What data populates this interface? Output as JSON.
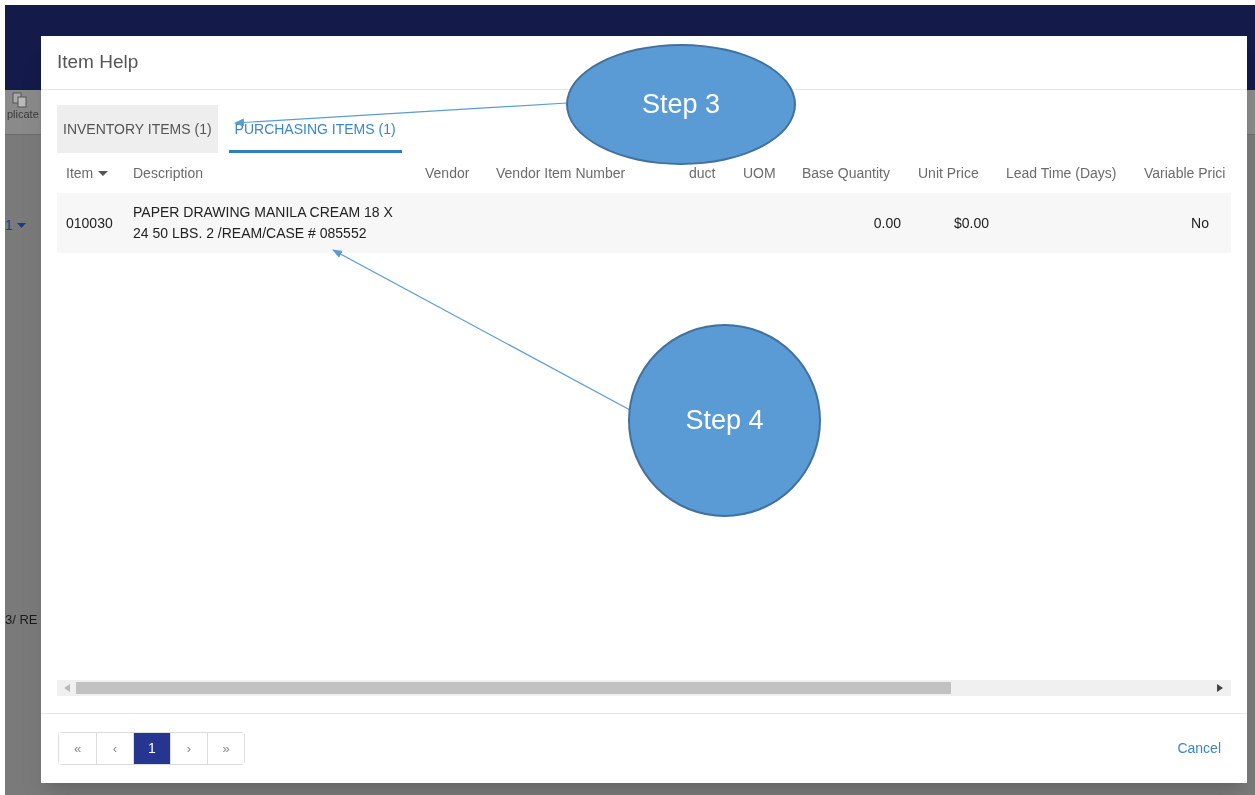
{
  "background": {
    "toolbar_label": "plicate",
    "field_value": "1",
    "text_fragment": "3/ RE"
  },
  "dialog": {
    "title": "Item Help",
    "tabs": [
      {
        "label": "INVENTORY ITEMS (1)",
        "selected": false
      },
      {
        "label": "PURCHASING ITEMS (1)",
        "selected": true
      }
    ],
    "table": {
      "columns": [
        {
          "label": "Item",
          "sorted": true,
          "kind": "text"
        },
        {
          "label": "Description",
          "sorted": false,
          "kind": "text"
        },
        {
          "label": "Vendor",
          "sorted": false,
          "kind": "text"
        },
        {
          "label": "Vendor Item Number",
          "sorted": false,
          "kind": "text"
        },
        {
          "label": "duct",
          "sorted": false,
          "kind": "text"
        },
        {
          "label": "UOM",
          "sorted": false,
          "kind": "text"
        },
        {
          "label": "Base Quantity",
          "sorted": false,
          "kind": "number"
        },
        {
          "label": "Unit Price",
          "sorted": false,
          "kind": "number"
        },
        {
          "label": "Lead Time (Days)",
          "sorted": false,
          "kind": "number"
        },
        {
          "label": "Variable Prici",
          "sorted": false,
          "kind": "number"
        }
      ],
      "rows": [
        {
          "cells": [
            "010030",
            "PAPER DRAWING MANILA CREAM 18 X 24 50 LBS. 2 /REAM/CASE # 085552",
            null,
            null,
            null,
            null,
            "0.00",
            "$0.00",
            null,
            "No"
          ]
        }
      ]
    },
    "pagination": [
      {
        "label": "«",
        "selected": false
      },
      {
        "label": "‹",
        "selected": false
      },
      {
        "label": "1",
        "selected": true
      },
      {
        "label": "›",
        "selected": false
      },
      {
        "label": "»",
        "selected": false
      }
    ],
    "cancel": "Cancel"
  },
  "callouts": [
    {
      "label": "Step 3"
    },
    {
      "label": "Step 4"
    }
  ]
}
